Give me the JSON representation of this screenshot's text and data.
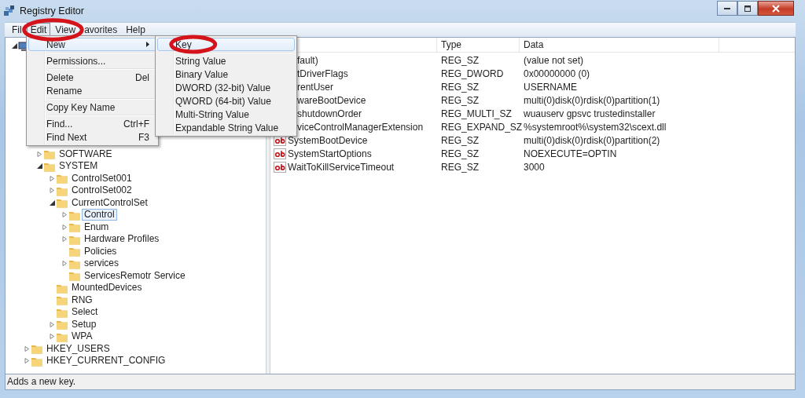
{
  "window": {
    "title": "Registry Editor"
  },
  "menu_bar": [
    {
      "label": "Fil",
      "selected": false,
      "circled": false
    },
    {
      "label": "Edit",
      "selected": true,
      "circled": true
    },
    {
      "label": "View",
      "selected": false,
      "circled": false
    },
    {
      "label": "avorites",
      "selected": false,
      "circled": false
    },
    {
      "label": "Help",
      "selected": false,
      "circled": false
    }
  ],
  "edit_menu": [
    {
      "kind": "item",
      "label": "New",
      "submenu": true,
      "selected": true
    },
    {
      "kind": "separator"
    },
    {
      "kind": "item",
      "label": "Permissions...",
      "submenu": false,
      "selected": false
    },
    {
      "kind": "separator"
    },
    {
      "kind": "item",
      "label": "Delete",
      "shortcut": "Del",
      "submenu": false,
      "selected": false
    },
    {
      "kind": "item",
      "label": "Rename",
      "submenu": false,
      "selected": false
    },
    {
      "kind": "separator"
    },
    {
      "kind": "item",
      "label": "Copy Key Name",
      "submenu": false,
      "selected": false
    },
    {
      "kind": "separator"
    },
    {
      "kind": "item",
      "label": "Find...",
      "shortcut": "Ctrl+F",
      "submenu": false,
      "selected": false
    },
    {
      "kind": "item",
      "label": "Find Next",
      "shortcut": "F3",
      "submenu": false,
      "selected": false
    }
  ],
  "new_submenu": [
    {
      "kind": "item",
      "label": "Key",
      "selected": true,
      "circled": true
    },
    {
      "kind": "separator"
    },
    {
      "kind": "item",
      "label": "String Value",
      "selected": false,
      "circled": false
    },
    {
      "kind": "item",
      "label": "Binary Value",
      "selected": false,
      "circled": false
    },
    {
      "kind": "item",
      "label": "DWORD (32-bit) Value",
      "selected": false,
      "circled": false
    },
    {
      "kind": "item",
      "label": "QWORD (64-bit) Value",
      "selected": false,
      "circled": false
    },
    {
      "kind": "item",
      "label": "Multi-String Value",
      "selected": false,
      "circled": false
    },
    {
      "kind": "item",
      "label": "Expandable String Value",
      "selected": false,
      "circled": false
    }
  ],
  "tree": [
    {
      "kind": "computer",
      "expanded": true,
      "children": [
        {
          "children": [
            {
              "label": "SOFTWARE",
              "expanded": false,
              "selected": false
            },
            {
              "label": "SYSTEM",
              "expanded": true,
              "selected": false,
              "children": [
                {
                  "label": "ControlSet001",
                  "expanded": false,
                  "selected": false
                },
                {
                  "label": "ControlSet002",
                  "expanded": false,
                  "selected": false
                },
                {
                  "label": "CurrentControlSet",
                  "expanded": true,
                  "selected": false,
                  "children": [
                    {
                      "label": "Control",
                      "expanded": false,
                      "selected": true
                    },
                    {
                      "label": "Enum",
                      "expanded": false,
                      "selected": false
                    },
                    {
                      "label": "Hardware Profiles",
                      "expanded": false,
                      "selected": false
                    },
                    {
                      "label": "Policies",
                      "selected": false
                    },
                    {
                      "label": "services",
                      "expanded": false,
                      "selected": false
                    },
                    {
                      "label": "ServicesRemotr Service",
                      "selected": false
                    }
                  ]
                },
                {
                  "label": "MountedDevices",
                  "selected": false
                },
                {
                  "label": "RNG",
                  "selected": false
                },
                {
                  "label": "Select",
                  "selected": false
                },
                {
                  "label": "Setup",
                  "expanded": false,
                  "selected": false
                },
                {
                  "label": "WPA",
                  "expanded": false,
                  "selected": false
                }
              ]
            }
          ]
        },
        {
          "label": "HKEY_USERS",
          "expanded": false,
          "selected": false
        },
        {
          "label": "HKEY_CURRENT_CONFIG",
          "expanded": false,
          "selected": false
        }
      ]
    }
  ],
  "values_table": {
    "columns": [
      "Type",
      "Data"
    ],
    "rows": [
      {
        "name": "fault)",
        "type": "REG_SZ",
        "data": "(value not set)"
      },
      {
        "name": "tDriverFlags",
        "type": "REG_DWORD",
        "data": "0x00000000 (0)"
      },
      {
        "name": "rentUser",
        "type": "REG_SZ",
        "data": "USERNAME"
      },
      {
        "name": "wareBootDevice",
        "type": "REG_SZ",
        "data": "multi(0)disk(0)rdisk(0)partition(1)"
      },
      {
        "name": "shutdownOrder",
        "type": "REG_MULTI_SZ",
        "data": "wuauserv gpsvc trustedinstaller"
      },
      {
        "name": "viceControlManagerExtension",
        "type": "REG_EXPAND_SZ",
        "data": "%systemroot%\\system32\\scext.dll"
      },
      {
        "kind": "string",
        "name": "SystemBootDevice",
        "type": "REG_SZ",
        "data": "multi(0)disk(0)rdisk(0)partition(2)"
      },
      {
        "kind": "string",
        "name": "SystemStartOptions",
        "type": "REG_SZ",
        "data": "NOEXECUTE=OPTIN"
      },
      {
        "kind": "string",
        "name": "WaitToKillServiceTimeout",
        "type": "REG_SZ",
        "data": "3000"
      }
    ]
  },
  "status_bar": "Adds a new key."
}
